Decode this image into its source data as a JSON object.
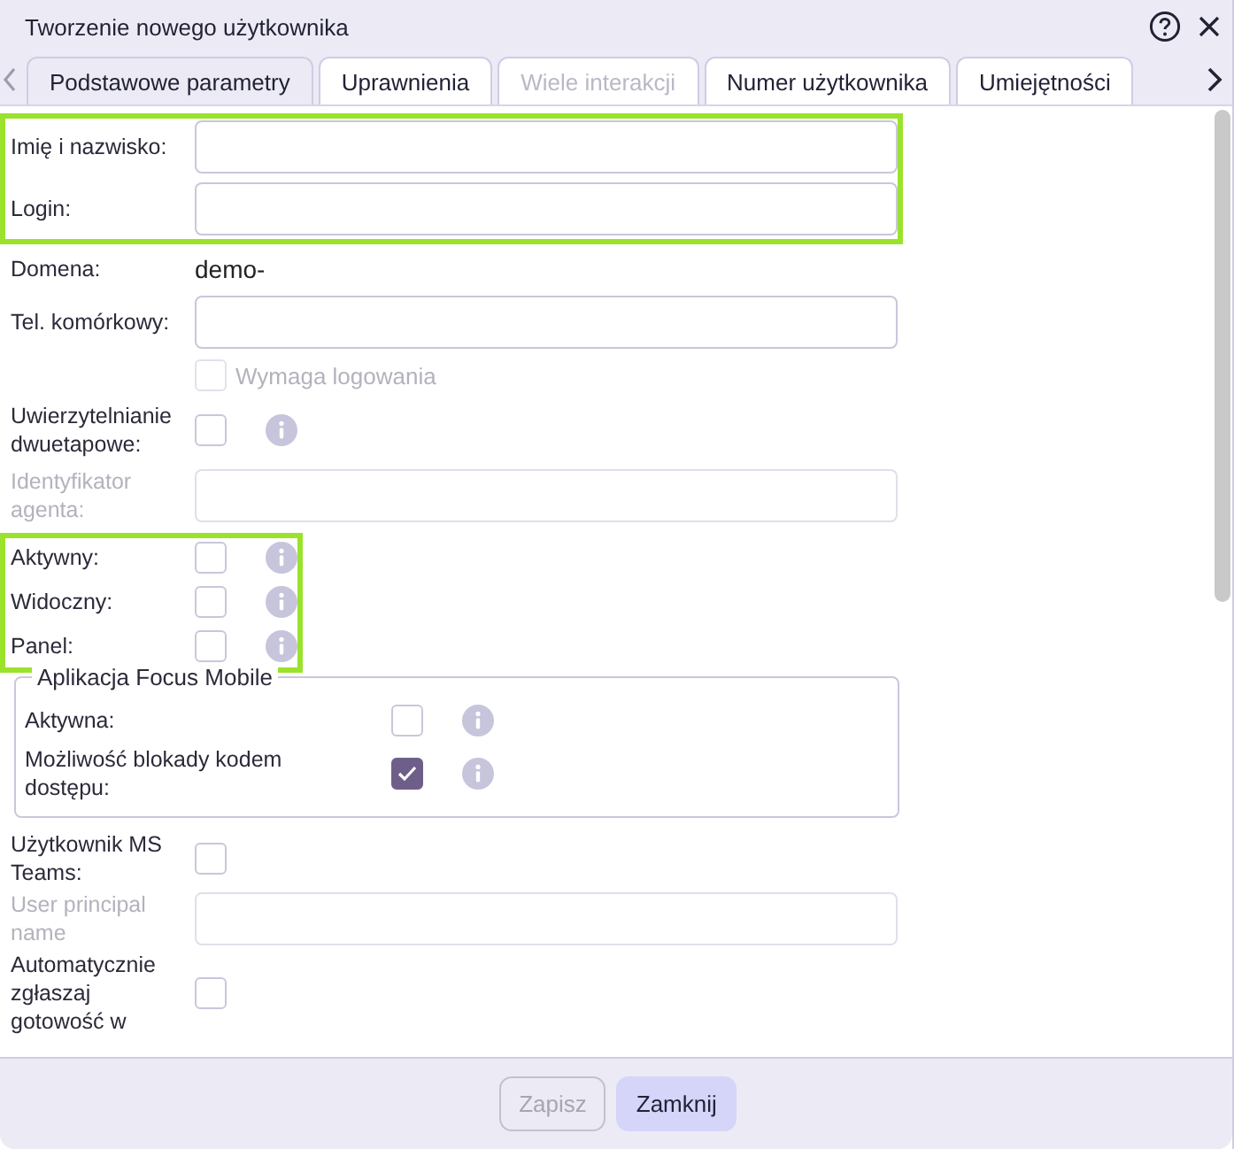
{
  "window": {
    "title": "Tworzenie nowego użytkownika"
  },
  "tabs": [
    {
      "label": "Podstawowe parametry",
      "selected": true,
      "disabled": false
    },
    {
      "label": "Uprawnienia",
      "selected": false,
      "disabled": false
    },
    {
      "label": "Wiele interakcji",
      "selected": false,
      "disabled": true
    },
    {
      "label": "Numer użytkownika",
      "selected": false,
      "disabled": false
    },
    {
      "label": "Umiejętności",
      "selected": false,
      "disabled": false
    }
  ],
  "form": [
    {
      "kind": "group",
      "highlighted": true,
      "rows": [
        {
          "kind": "input",
          "label": "Imię i nazwisko:",
          "disabled": false
        },
        {
          "kind": "input",
          "label": "Login:",
          "disabled": false
        }
      ]
    },
    {
      "kind": "group",
      "highlighted": false,
      "rows": [
        {
          "kind": "value",
          "label": "Domena:",
          "value": "demo-"
        },
        {
          "kind": "input",
          "label": "Tel. komórkowy:",
          "disabled": false
        },
        {
          "kind": "option",
          "label": "Wymaga logowania",
          "checked": false,
          "disabled": true
        },
        {
          "kind": "checkbox",
          "label": "Uwierzytelnianie dwuetapowe:",
          "checked": false,
          "info": true
        },
        {
          "kind": "input",
          "label": "Identyfikator agenta:",
          "disabled": true
        }
      ]
    },
    {
      "kind": "group",
      "highlighted": true,
      "rows": [
        {
          "kind": "checkbox",
          "label": "Aktywny:",
          "checked": false,
          "info": true
        },
        {
          "kind": "checkbox",
          "label": "Widoczny:",
          "checked": false,
          "info": true
        },
        {
          "kind": "checkbox",
          "label": "Panel:",
          "checked": false,
          "info": true
        }
      ]
    },
    {
      "kind": "fieldset",
      "legend": "Aplikacja Focus Mobile",
      "rows": [
        {
          "kind": "checkbox",
          "label": "Aktywna:",
          "checked": false,
          "info": true
        },
        {
          "kind": "checkbox",
          "label": "Możliwość blokady kodem dostępu:",
          "checked": true,
          "info": true
        }
      ]
    },
    {
      "kind": "group",
      "highlighted": false,
      "rows": [
        {
          "kind": "checkbox",
          "label": "Użytkownik MS Teams:",
          "checked": false,
          "info": false
        },
        {
          "kind": "input",
          "label": "User principal name",
          "disabled": true
        },
        {
          "kind": "checkbox",
          "label": "Automatycznie zgłaszaj gotowość w",
          "checked": false,
          "info": false
        }
      ]
    }
  ],
  "buttons": [
    {
      "label": "Zapisz",
      "kind": "secondary",
      "disabled": true
    },
    {
      "label": "Zamknij",
      "kind": "primary",
      "disabled": false
    }
  ]
}
